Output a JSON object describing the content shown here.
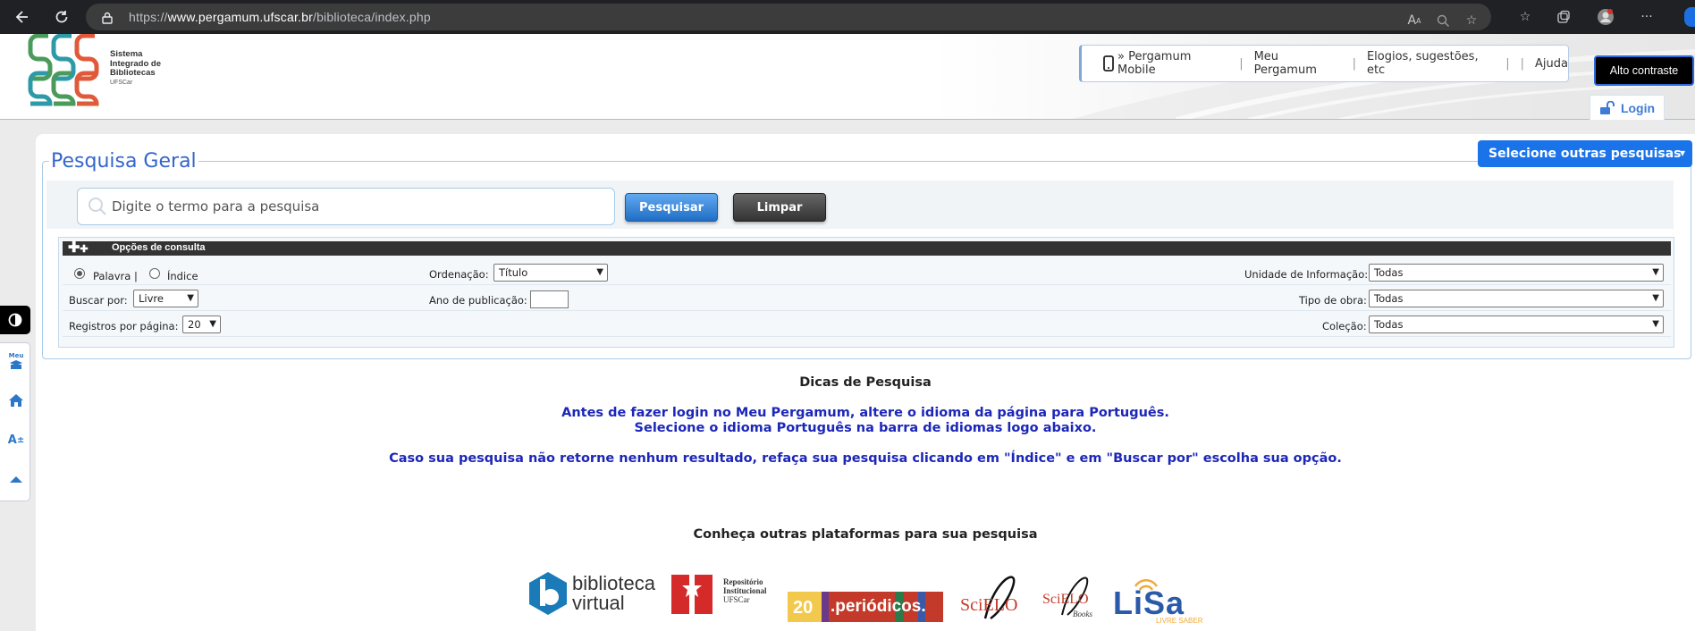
{
  "browser": {
    "url_prefix": "https://",
    "url_domain": "www.pergamum.ufscar.br",
    "url_path": "/biblioteca/index.php"
  },
  "header": {
    "logo_lines": [
      "Sistema",
      "Integrado de",
      "Bibliotecas"
    ],
    "logo_sub": "UFSCar",
    "links": {
      "mobile": "» Pergamum Mobile",
      "meu": "Meu Pergamum",
      "elogios": "Elogios, sugestões, etc",
      "ajuda": "Ajuda"
    },
    "contrast": "Alto contraste",
    "login": "Login"
  },
  "search": {
    "legend": "Pesquisa Geral",
    "other_searches": "Selecione outras pesquisas",
    "placeholder": "Digite o termo para a pesquisa",
    "btn_search": "Pesquisar",
    "btn_clear": "Limpar",
    "options_title": "Opções de consulta",
    "radio_palavra": "Palavra |",
    "radio_indice": "Índice",
    "ordenacao_label": "Ordenação:",
    "ordenacao_value": "Título",
    "unidade_label": "Unidade de Informação:",
    "unidade_value": "Todas",
    "buscar_label": "Buscar por:",
    "buscar_value": "Livre",
    "ano_label": "Ano de publicação:",
    "tipo_label": "Tipo de obra:",
    "tipo_value": "Todas",
    "registros_label": "Registros por página:",
    "registros_value": "20",
    "colecao_label": "Coleção:",
    "colecao_value": "Todas"
  },
  "tips": {
    "title": "Dicas de Pesquisa",
    "line1": "Antes de fazer login no Meu Pergamum, altere o idioma da página para Português.",
    "line2": "Selecione o idioma Português na barra de idiomas logo abaixo.",
    "line3": "Caso sua pesquisa não retorne nenhum resultado, refaça sua pesquisa clicando em \"Índice\" e em \"Buscar por\" escolha sua opção."
  },
  "platforms": {
    "title": "Conheça outras plataformas para sua pesquisa",
    "bv_line1": "biblioteca",
    "bv_line2": "virtual",
    "ri_line1": "Repositório",
    "ri_line2": "Institucional",
    "ri_line3": "UFSCar",
    "periodicos": ".periódicos.",
    "scielo": "SciELO",
    "scielo_books": "SciELO",
    "scielo_books_sub": "Books",
    "lisa": "LiSa",
    "lisa_sub": "LIVRE SABER"
  },
  "sidebar": {
    "meu_label": "Meu"
  },
  "colors": {
    "accent": "#1a73e8",
    "tips_blue": "#1c27b8",
    "legend_blue": "#3366cc"
  }
}
